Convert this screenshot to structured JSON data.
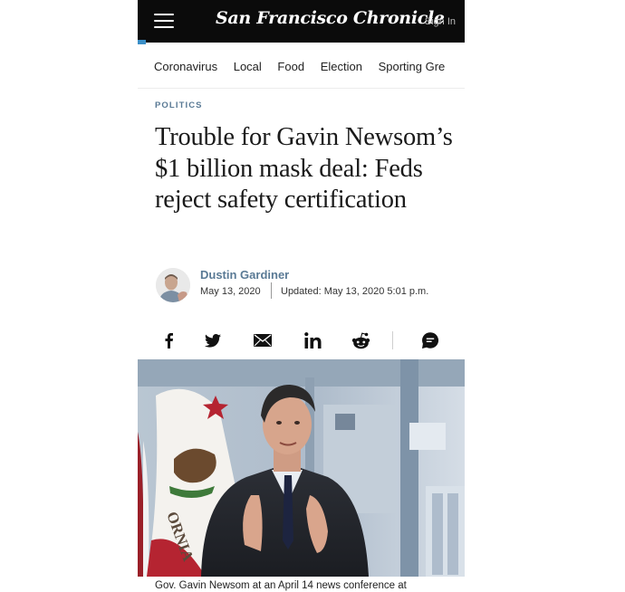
{
  "header": {
    "logo": "San Francisco Chronicle",
    "sign_in": "Sign In",
    "menu_icon": "hamburger-menu-icon"
  },
  "nav": {
    "items": [
      "Coronavirus",
      "Local",
      "Food",
      "Election",
      "Sporting Gre"
    ]
  },
  "article": {
    "section": "POLITICS",
    "headline": "Trouble for Gavin Newsom’s $1 billion mask deal: Feds reject safety certification",
    "author": "Dustin Gardiner",
    "date": "May 13, 2020",
    "updated": "Updated: May 13, 2020 5:01 p.m.",
    "caption": "Gov. Gavin Newsom at an April 14 news conference at"
  },
  "share": {
    "icons": [
      "facebook-icon",
      "twitter-icon",
      "email-icon",
      "linkedin-icon",
      "reddit-icon",
      "comment-icon"
    ]
  },
  "colors": {
    "topbar": "#0b0b0b",
    "accent": "#5a7a95",
    "progress": "#3a8fc7"
  }
}
